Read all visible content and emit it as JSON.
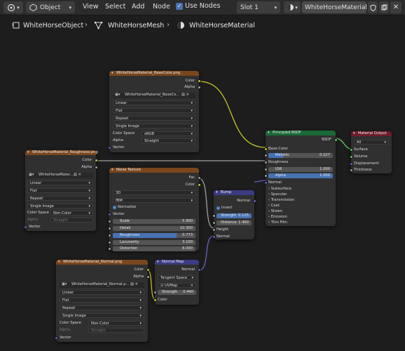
{
  "header": {
    "mode": "Object",
    "menus": [
      "View",
      "Select",
      "Add",
      "Node"
    ],
    "use_nodes": "Use Nodes",
    "slot": "Slot 1",
    "material_name": "WhiteHorseMaterial"
  },
  "breadcrumb": {
    "object": "WhiteHorseObject",
    "mesh": "WhiteHorseMesh",
    "material": "WhiteHorseMaterial"
  },
  "nodes": {
    "basecolor": {
      "title": "WhiteHorseMaterial_BaseColor.png",
      "out_color": "Color",
      "out_alpha": "Alpha",
      "image": "WhiteHorseMaterial_BaseCo...",
      "interp": "Linear",
      "proj": "Flat",
      "ext": "Repeat",
      "src": "Single Image",
      "cs_label": "Color Space",
      "cs_value": "sRGB",
      "alpha_label": "Alpha",
      "alpha_value": "Straight",
      "vector": "Vector"
    },
    "roughness": {
      "title": "WhiteHorseMaterial_Roughness.png",
      "out_color": "Color",
      "out_alpha": "Alpha",
      "image": "WhiteHorseMater...",
      "interp": "Linear",
      "proj": "Flat",
      "ext": "Repeat",
      "src": "Single Image",
      "cs_label": "Color Space",
      "cs_value": "Non-Color",
      "alpha_label": "Alpha",
      "alpha_value": "Straight",
      "vector": "Vector"
    },
    "noise": {
      "title": "Noise Texture",
      "out_fac": "Fac",
      "out_color": "Color",
      "dim": "3D",
      "type": "fBM",
      "normalize": "Normalize",
      "vector": "Vector",
      "scale_l": "Scale",
      "scale_v": "5.900",
      "detail_l": "Detail",
      "detail_v": "10.300",
      "rough_l": "Roughness",
      "rough_v": "0.773",
      "rough_frac": 0.773,
      "lac_l": "Lacunarity",
      "lac_v": "3.100",
      "dist_l": "Distortion",
      "dist_v": "6.000"
    },
    "bump": {
      "title": "Bump",
      "out_normal": "Normal",
      "invert": "Invert",
      "strength_l": "Strength",
      "strength_v": "0.125",
      "distance_l": "Distance",
      "distance_v": "1.400",
      "height": "Height",
      "normal": "Normal"
    },
    "normal_tex": {
      "title": "WhiteHorseMaterial_Normal.png",
      "out_color": "Color",
      "out_alpha": "Alpha",
      "image": "WhiteHorseMaterial_Normal.p...",
      "interp": "Linear",
      "proj": "Flat",
      "ext": "Repeat",
      "src": "Single Image",
      "cs_label": "Color Space",
      "cs_value": "Non-Color",
      "alpha_label": "Alpha",
      "alpha_value": "Straight",
      "vector": "Vector"
    },
    "normal_map": {
      "title": "Normal Map",
      "out_normal": "Normal",
      "space": "Tangent Space",
      "uv": "UVMap",
      "strength_l": "Strength",
      "strength_v": "0.440",
      "color": "Color"
    },
    "bsdf": {
      "title": "Principled BSDF",
      "out": "BSDF",
      "base_color": "Base Color",
      "metallic_l": "Metallic",
      "metallic_v": "0.227",
      "roughness": "Roughness",
      "ior_l": "IOR",
      "ior_v": "1.000",
      "alpha_l": "Alpha",
      "alpha_v": "1.000",
      "normal": "Normal",
      "panels": [
        "Subsurface",
        "Specular",
        "Transmission",
        "Coat",
        "Sheen",
        "Emission",
        "Thin Film"
      ]
    },
    "output": {
      "title": "Material Output",
      "target": "All",
      "surface": "Surface",
      "volume": "Volume",
      "displacement": "Displacement",
      "thickness": "Thickness"
    }
  },
  "colors": {
    "texture_header": "#79461d",
    "vector_header": "#3c3c83",
    "shader_header": "#1b6a36",
    "output_header": "#6e1d2a",
    "accent": "#4772b3"
  }
}
